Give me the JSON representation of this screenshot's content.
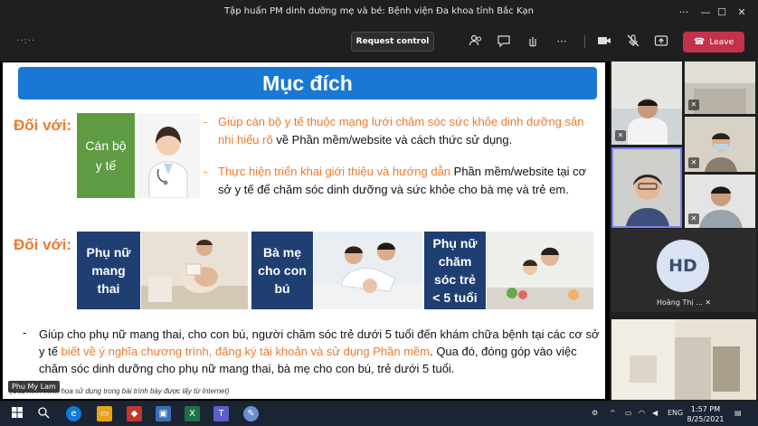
{
  "window": {
    "title": "Tập huấn PM dinh dưỡng mẹ và bé: Bệnh viện Đa khoa tỉnh Bắc Kạn",
    "controls": [
      "more-icon",
      "minimize-icon",
      "maximize-icon",
      "close-icon"
    ]
  },
  "toolbar": {
    "timer": "··:··",
    "request_control": "Request control",
    "icons": [
      "people-icon",
      "chat-icon",
      "raise-hand-icon",
      "more-icon",
      "camera-icon",
      "mic-off-icon",
      "share-icon"
    ],
    "leave": "Leave"
  },
  "slide": {
    "title": "Mục đích",
    "doi_voi_1": "Đối với:",
    "doi_voi_2": "Đối với:",
    "green_box": [
      "Cán bộ",
      "y tế"
    ],
    "bullet1_orange": "Giúp cán bộ y tế thuộc mạng lưới chăm sóc sức khỏe dinh dưỡng sản nhi hiểu rõ",
    "bullet1_rest": " về Phần mềm/website và cách thức sử dụng.",
    "bullet2_orange": "Thực hiện triển khai giới thiệu và hướng dẫn",
    "bullet2_rest": " Phần mềm/website tại cơ sở y tế để chăm sóc dinh dưỡng và sức khỏe cho bà mẹ và trẻ em.",
    "blue_boxes": [
      [
        "Phụ nữ",
        "mang",
        "thai"
      ],
      [
        "Bà mẹ",
        "cho con",
        "bú"
      ],
      [
        "Phụ nữ",
        "chăm",
        "sóc trẻ",
        "< 5 tuổi"
      ]
    ],
    "bottom_dash": "-",
    "bottom_text_1": "Giúp cho phụ nữ mang thai, cho con bú, người chăm sóc trẻ dưới 5 tuổi đến khám chữa bệnh tại các cơ sở y tế ",
    "bottom_text_orange": "biết về ý nghĩa chương trình, đăng ký tài khoản và sử dụng Phần mềm",
    "bottom_text_2": ". Qua đó, đóng góp vào việc chăm sóc dinh dưỡng cho phụ nữ mang thai, bà mẹ cho con bú, trẻ dưới 5 tuổi.",
    "footnote": "(Các hình minh họa sử dụng trong bài trình bày được lấy từ Internet)"
  },
  "presenter": "Phu My Lam",
  "participants": {
    "hd_initials": "HD",
    "hd_name": "Hoàng Thị ..."
  },
  "taskbar": {
    "lang": "ENG",
    "time": "1:57 PM",
    "date": "8/25/2021"
  },
  "colors": {
    "slide_title_bg": "#1a78d4",
    "accent_orange": "#ec7a30",
    "green_box": "#5f9b43",
    "navy_box": "#1f3f73",
    "leave_red": "#c4314b",
    "active_border": "#7b83eb"
  }
}
